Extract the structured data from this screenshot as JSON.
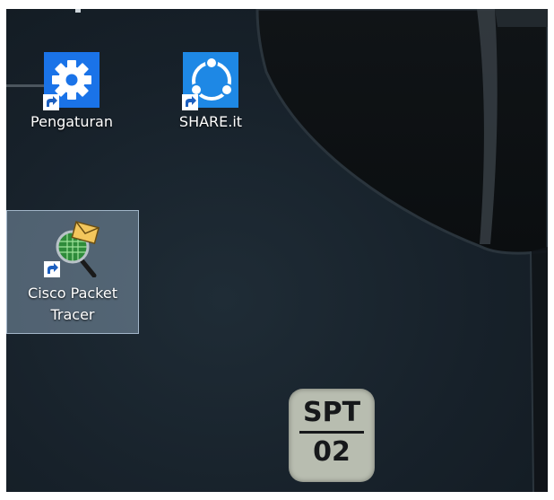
{
  "desktop": {
    "icons": [
      {
        "label": "Pengaturan",
        "icon": "settings-gear-icon",
        "color": "#1a73e8"
      },
      {
        "label": "SHARE.it",
        "icon": "shareit-icon",
        "color": "#1e88e5"
      },
      {
        "label": "Cisco Packet Tracer",
        "icon": "cisco-packet-tracer-icon",
        "selected": true
      }
    ],
    "badge": {
      "top": "SPT",
      "bottom": "02"
    }
  }
}
